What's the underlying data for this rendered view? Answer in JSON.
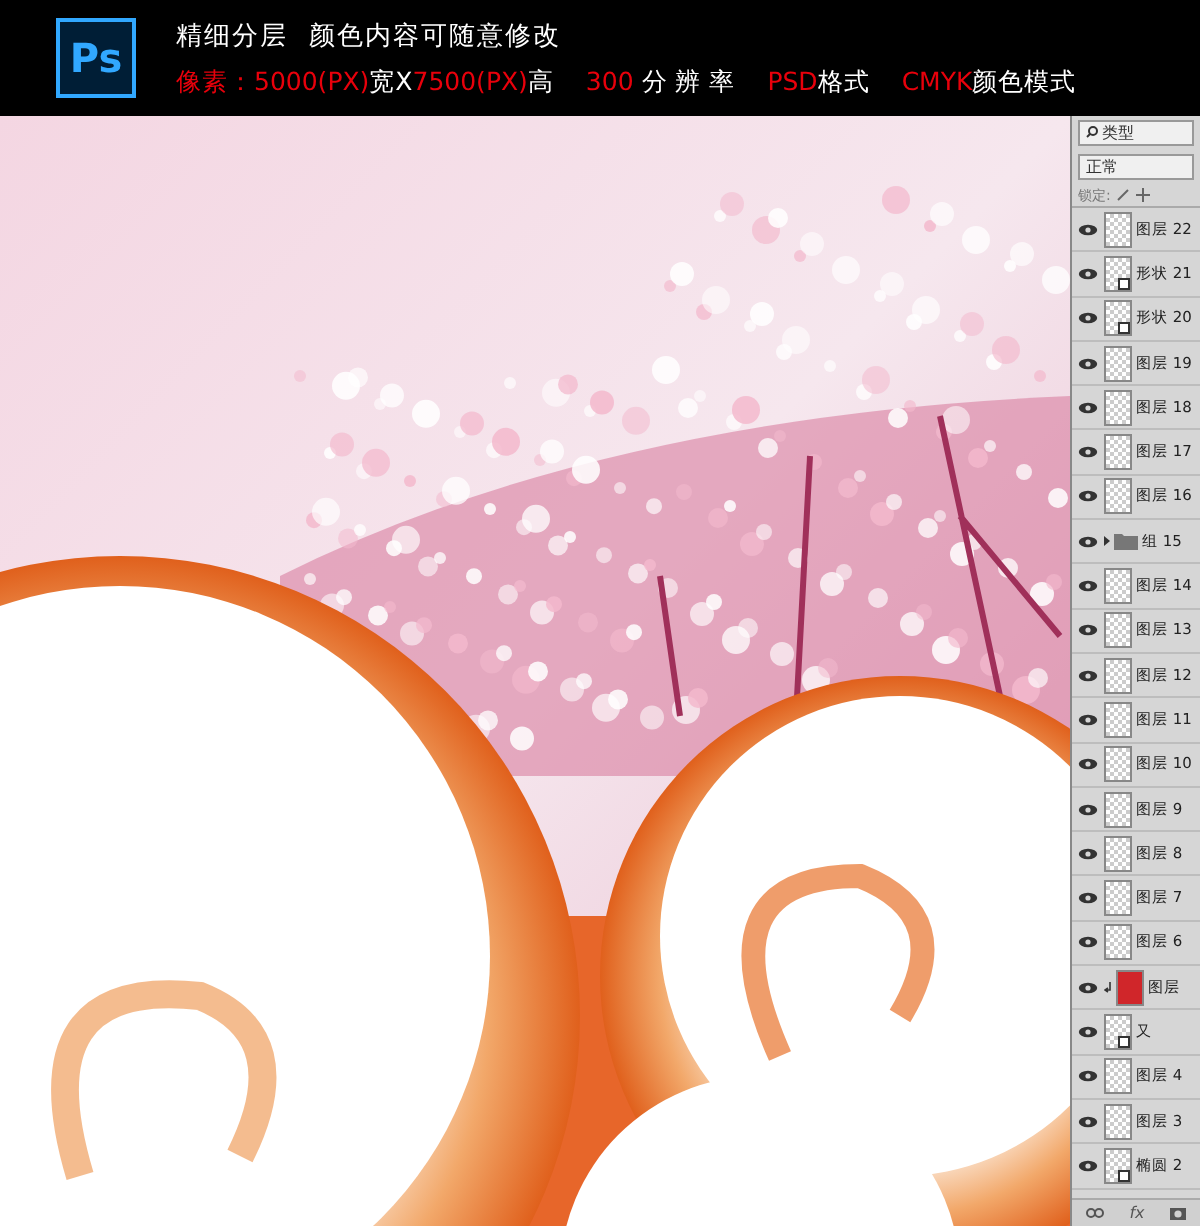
{
  "header": {
    "logo": "Ps",
    "title": "精细分层  颜色内容可随意修改",
    "specs": [
      [
        {
          "text": "像素：5000(PX)",
          "highlight": true
        },
        {
          "text": "宽X",
          "highlight": false
        },
        {
          "text": "7500(PX)",
          "highlight": true
        },
        {
          "text": "高",
          "highlight": false
        }
      ],
      [
        {
          "text": "300",
          "highlight": true
        },
        {
          "text": " 分 辨 率",
          "highlight": false
        }
      ],
      [
        {
          "text": "PSD",
          "highlight": true
        },
        {
          "text": "格式",
          "highlight": false
        }
      ],
      [
        {
          "text": "CMYK",
          "highlight": true
        },
        {
          "text": "颜色模式",
          "highlight": false
        }
      ]
    ]
  },
  "layers_panel": {
    "filter": "类型",
    "blend_mode": "正常",
    "lock_label": "锁定:",
    "layers": [
      {
        "kind": "layer",
        "name": "图层 22",
        "visible": true
      },
      {
        "kind": "shape",
        "name": "形状 21",
        "visible": true
      },
      {
        "kind": "shape",
        "name": "形状 20",
        "visible": true
      },
      {
        "kind": "layer",
        "name": "图层 19",
        "visible": true
      },
      {
        "kind": "layer",
        "name": "图层 18",
        "visible": true
      },
      {
        "kind": "layer",
        "name": "图层 17",
        "visible": true
      },
      {
        "kind": "layer",
        "name": "图层 16",
        "visible": true
      },
      {
        "kind": "group",
        "name": "组 15",
        "visible": true
      },
      {
        "kind": "layer",
        "name": "图层 14",
        "visible": true
      },
      {
        "kind": "layer",
        "name": "图层 13",
        "visible": true
      },
      {
        "kind": "layer",
        "name": "图层 12",
        "visible": true
      },
      {
        "kind": "layer",
        "name": "图层 11",
        "visible": true
      },
      {
        "kind": "layer",
        "name": "图层 10",
        "visible": true
      },
      {
        "kind": "layer",
        "name": "图层 9",
        "visible": true
      },
      {
        "kind": "layer",
        "name": "图层 8",
        "visible": true
      },
      {
        "kind": "layer",
        "name": "图层 7",
        "visible": true
      },
      {
        "kind": "layer",
        "name": "图层 6",
        "visible": true
      },
      {
        "kind": "clipped",
        "name": "图层",
        "visible": true
      },
      {
        "kind": "shape",
        "name": "又",
        "visible": true
      },
      {
        "kind": "layer",
        "name": "图层 4",
        "visible": true
      },
      {
        "kind": "layer",
        "name": "图层 3",
        "visible": true
      },
      {
        "kind": "shape",
        "name": "椭圆 2",
        "visible": true
      }
    ],
    "footer_fx": "fx"
  }
}
